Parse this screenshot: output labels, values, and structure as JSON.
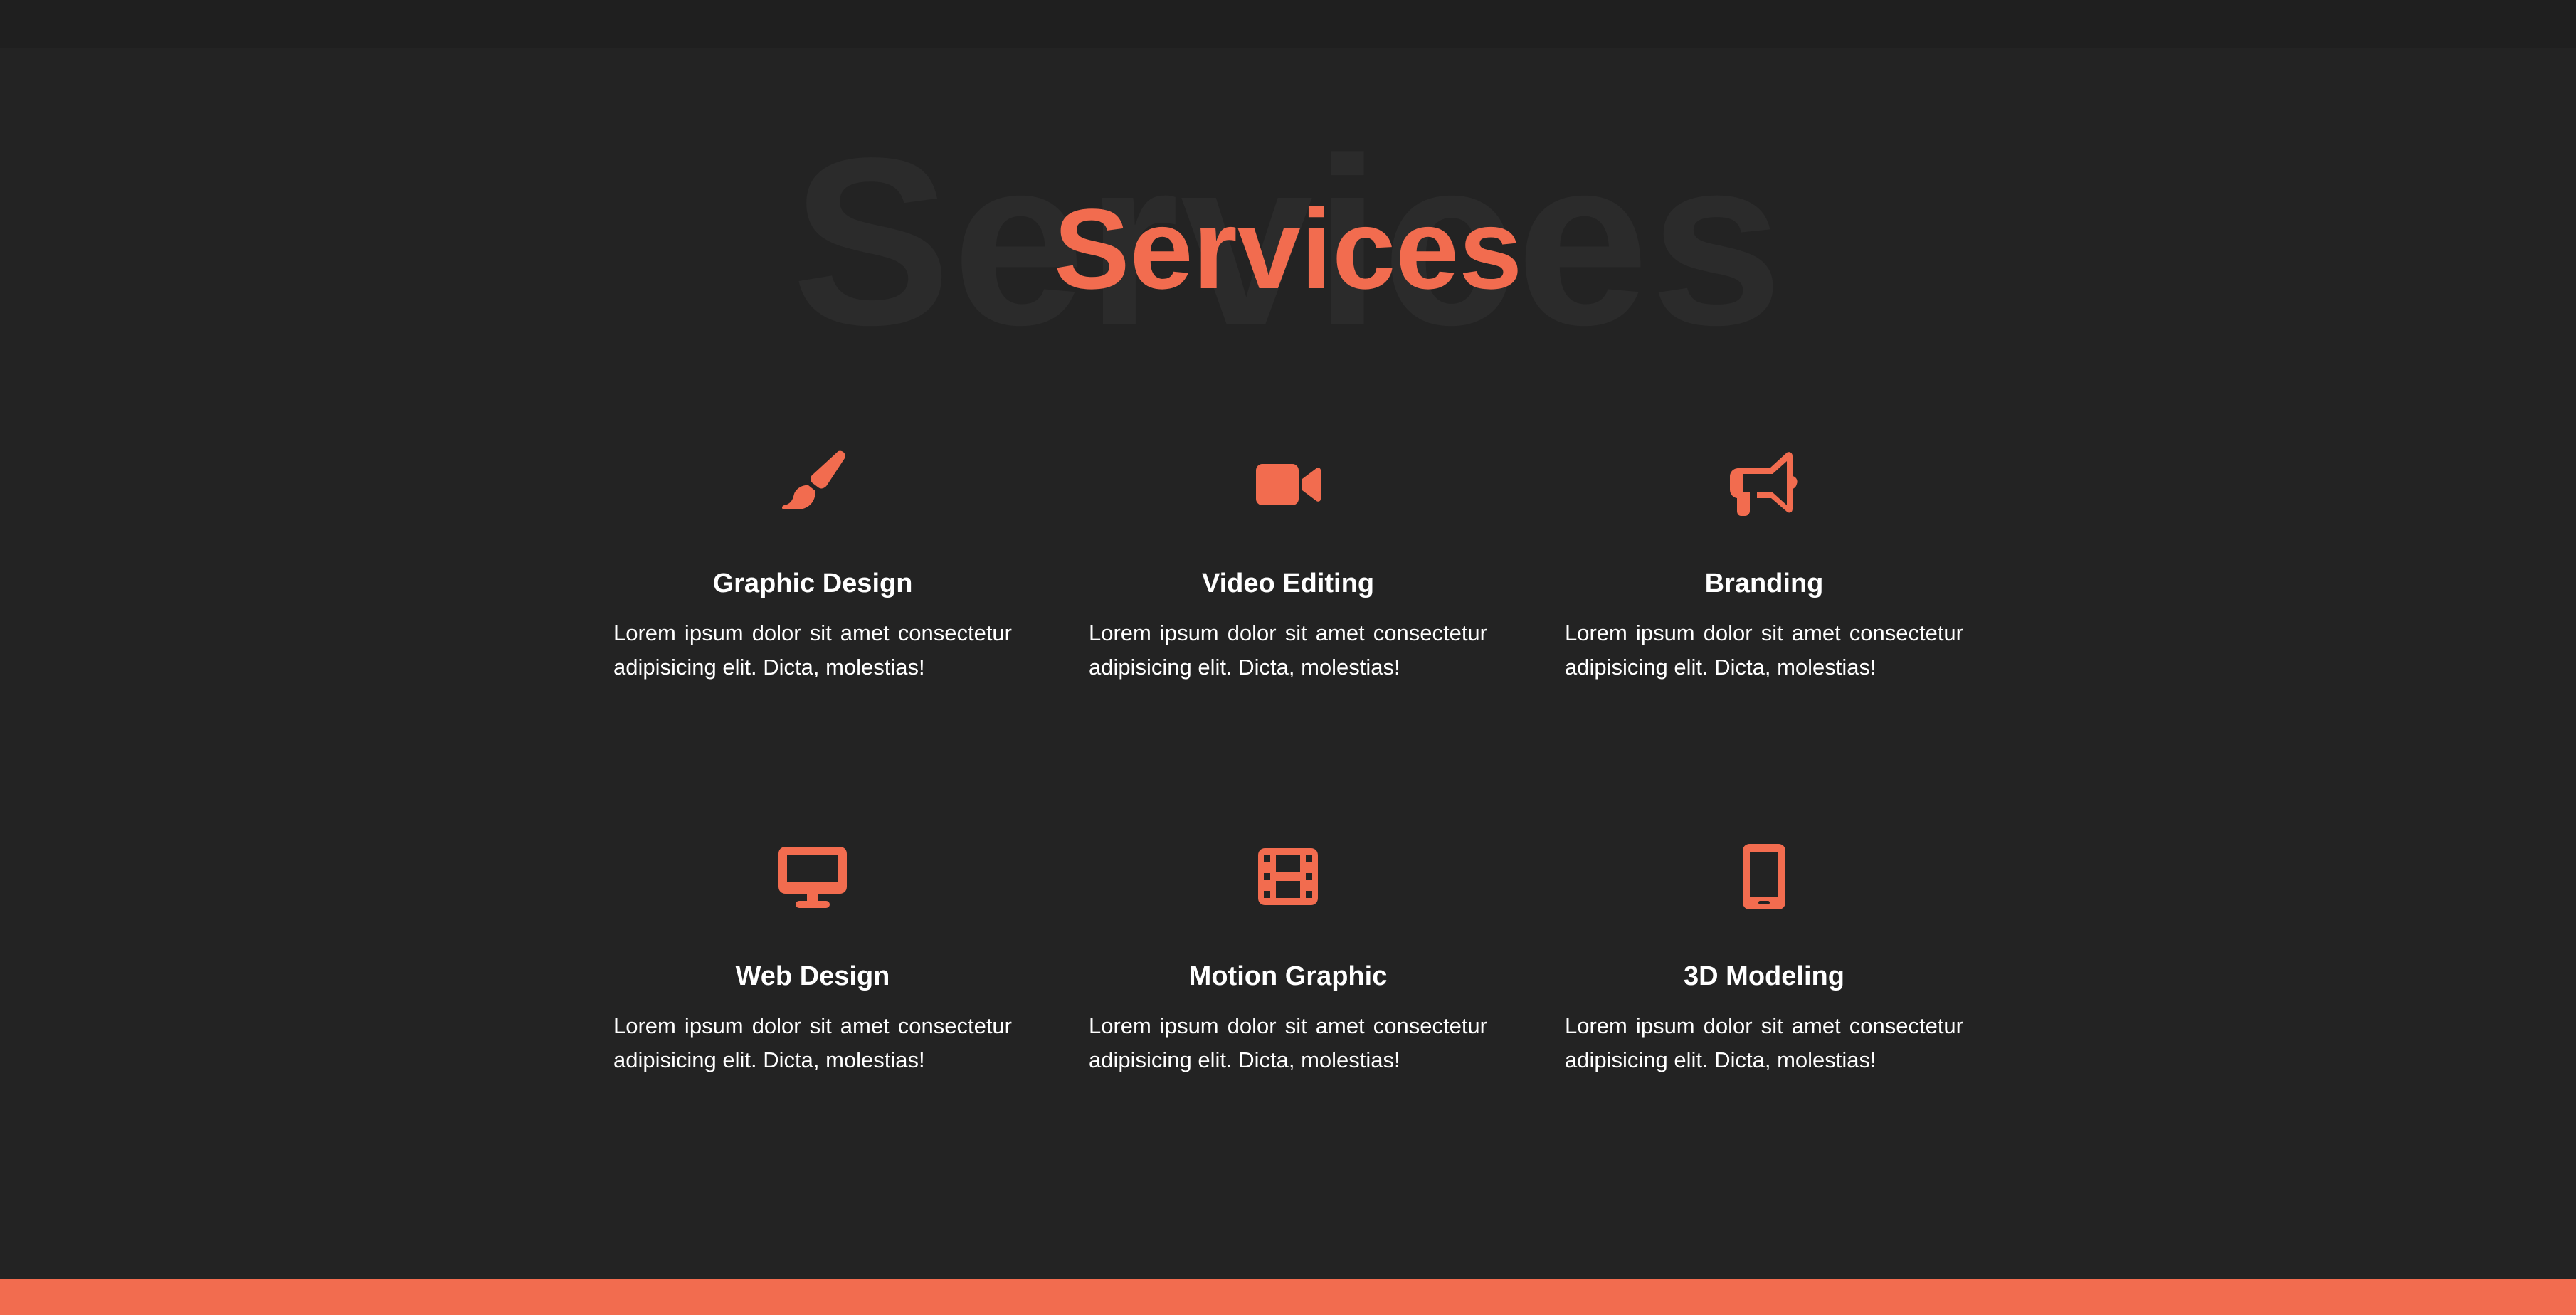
{
  "section": {
    "background_word": "Services",
    "title": "Services"
  },
  "colors": {
    "accent": "#f26c4f",
    "background": "#232323",
    "text": "#ffffff"
  },
  "services": [
    {
      "icon": "paintbrush-icon",
      "title": "Graphic Design",
      "description": "Lorem ipsum dolor sit amet consectetur adipisicing elit. Dicta, molestias!"
    },
    {
      "icon": "video-camera-icon",
      "title": "Video Editing",
      "description": "Lorem ipsum dolor sit amet consectetur adipisicing elit. Dicta, molestias!"
    },
    {
      "icon": "megaphone-icon",
      "title": "Branding",
      "description": "Lorem ipsum dolor sit amet consectetur adipisicing elit. Dicta, molestias!"
    },
    {
      "icon": "desktop-icon",
      "title": "Web Design",
      "description": "Lorem ipsum dolor sit amet consectetur adipisicing elit. Dicta, molestias!"
    },
    {
      "icon": "film-icon",
      "title": "Motion Graphic",
      "description": "Lorem ipsum dolor sit amet consectetur adipisicing elit. Dicta, molestias!"
    },
    {
      "icon": "mobile-phone-icon",
      "title": "3D Modeling",
      "description": "Lorem ipsum dolor sit amet consectetur adipisicing elit. Dicta, molestias!"
    }
  ]
}
